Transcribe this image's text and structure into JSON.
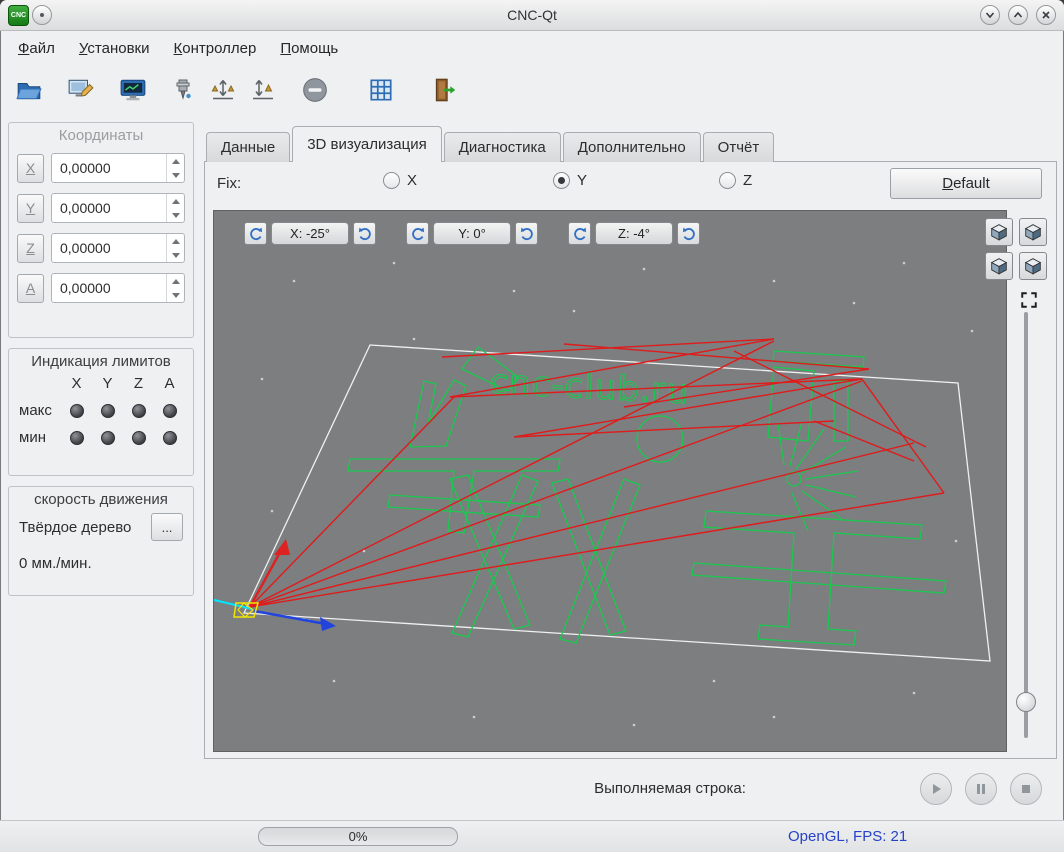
{
  "window": {
    "title": "CNC-Qt",
    "app_icon_text": "CNC"
  },
  "menu": {
    "items": [
      {
        "label": "Файл"
      },
      {
        "label": "Установки"
      },
      {
        "label": "Контроллер"
      },
      {
        "label": "Помощь"
      }
    ]
  },
  "toolbar": {
    "items": [
      {
        "name": "open-file-button",
        "icon": "open-folder-icon"
      },
      {
        "name": "program-settings-button",
        "icon": "edit-settings-icon"
      },
      {
        "name": "controller-settings-button",
        "icon": "monitor-icon"
      },
      {
        "name": "spindle-button",
        "icon": "spindle-icon"
      },
      {
        "name": "measure-tool-button",
        "icon": "scale-x-icon"
      },
      {
        "name": "tool-offset-button",
        "icon": "scale-z-icon"
      },
      {
        "name": "emergency-stop-button",
        "icon": "stop-icon"
      },
      {
        "name": "grid-button",
        "icon": "grid-icon"
      },
      {
        "name": "exit-button",
        "icon": "exit-door-icon"
      }
    ]
  },
  "coordinates": {
    "title": "Координаты",
    "axes": [
      {
        "label": "X",
        "value": "0,00000"
      },
      {
        "label": "Y",
        "value": "0,00000"
      },
      {
        "label": "Z",
        "value": "0,00000"
      },
      {
        "label": "A",
        "value": "0,00000"
      }
    ]
  },
  "limits": {
    "title": "Индикация лимитов",
    "columns": [
      "X",
      "Y",
      "Z",
      "A"
    ],
    "rows": [
      {
        "label": "макс"
      },
      {
        "label": "мин"
      }
    ]
  },
  "speed": {
    "title": "скорость движения",
    "material": "Твёрдое дерево",
    "more_button": "...",
    "value": "0 мм./мин."
  },
  "tabs": [
    {
      "label": "Данные",
      "active": false
    },
    {
      "label": "3D визуализация",
      "active": true
    },
    {
      "label": "Диагностика",
      "active": false
    },
    {
      "label": "Дополнительно",
      "active": false
    },
    {
      "label": "Отчёт",
      "active": false
    }
  ],
  "fix": {
    "label": "Fix:",
    "options": [
      {
        "label": "X",
        "selected": false
      },
      {
        "label": "Y",
        "selected": true
      },
      {
        "label": "Z",
        "selected": false
      }
    ],
    "default_button": "Default"
  },
  "viewport": {
    "rotation": [
      {
        "axis": "X",
        "label": "X: -25°"
      },
      {
        "axis": "Y",
        "label": "Y: 0°"
      },
      {
        "axis": "Z",
        "label": "Z: -4°"
      }
    ],
    "watermark": "cnc-club.ru",
    "colors": {
      "work_path": "#1ac94f",
      "rapid_path": "#e01b1b",
      "border": "#f0f0f0",
      "background": "#7c7e7f"
    }
  },
  "footer": {
    "label": "Выполняемая строка:"
  },
  "statusbar": {
    "progress": "0%",
    "info": "OpenGL, FPS: 21"
  }
}
